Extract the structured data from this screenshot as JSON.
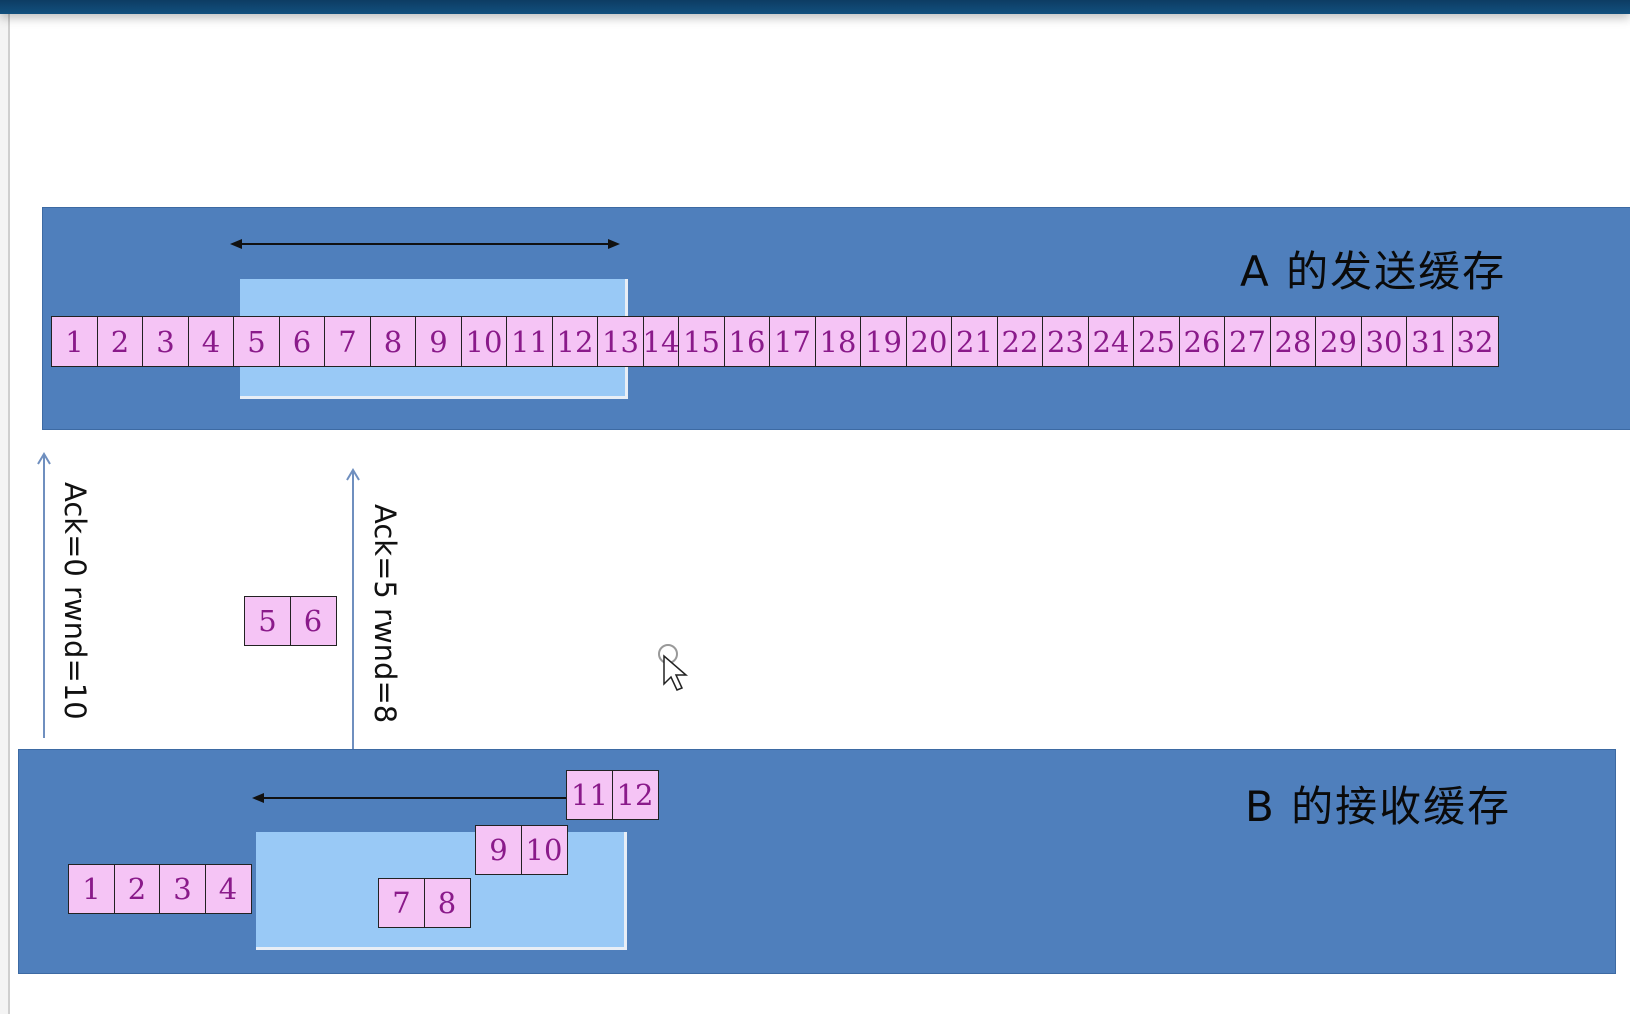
{
  "sender": {
    "title": "A 的发送缓存",
    "cells": [
      "1",
      "2",
      "3",
      "4",
      "5",
      "6",
      "7",
      "8",
      "9",
      "10",
      "11",
      "12",
      "13",
      "14",
      "15",
      "16",
      "17",
      "18",
      "19",
      "20",
      "21",
      "22",
      "23",
      "24",
      "25",
      "26",
      "27",
      "28",
      "29",
      "30",
      "31",
      "32"
    ]
  },
  "receiver": {
    "title": "B 的接收缓存",
    "delivered": [
      "1",
      "2",
      "3",
      "4"
    ],
    "segments_7_8": [
      "7",
      "8"
    ],
    "segments_9_10": [
      "9",
      "10"
    ],
    "segments_11_12": [
      "11",
      "12"
    ]
  },
  "in_flight": {
    "segments": [
      "5",
      "6"
    ]
  },
  "acks": {
    "ack1": "Ack=0 rwnd=10",
    "ack2": "Ack=5 rwnd=8"
  },
  "colors": {
    "panel": "#4f7fbc",
    "window": "#99c9f6",
    "segment_fill": "#f5c4f5",
    "segment_text": "#8a1a8a"
  }
}
